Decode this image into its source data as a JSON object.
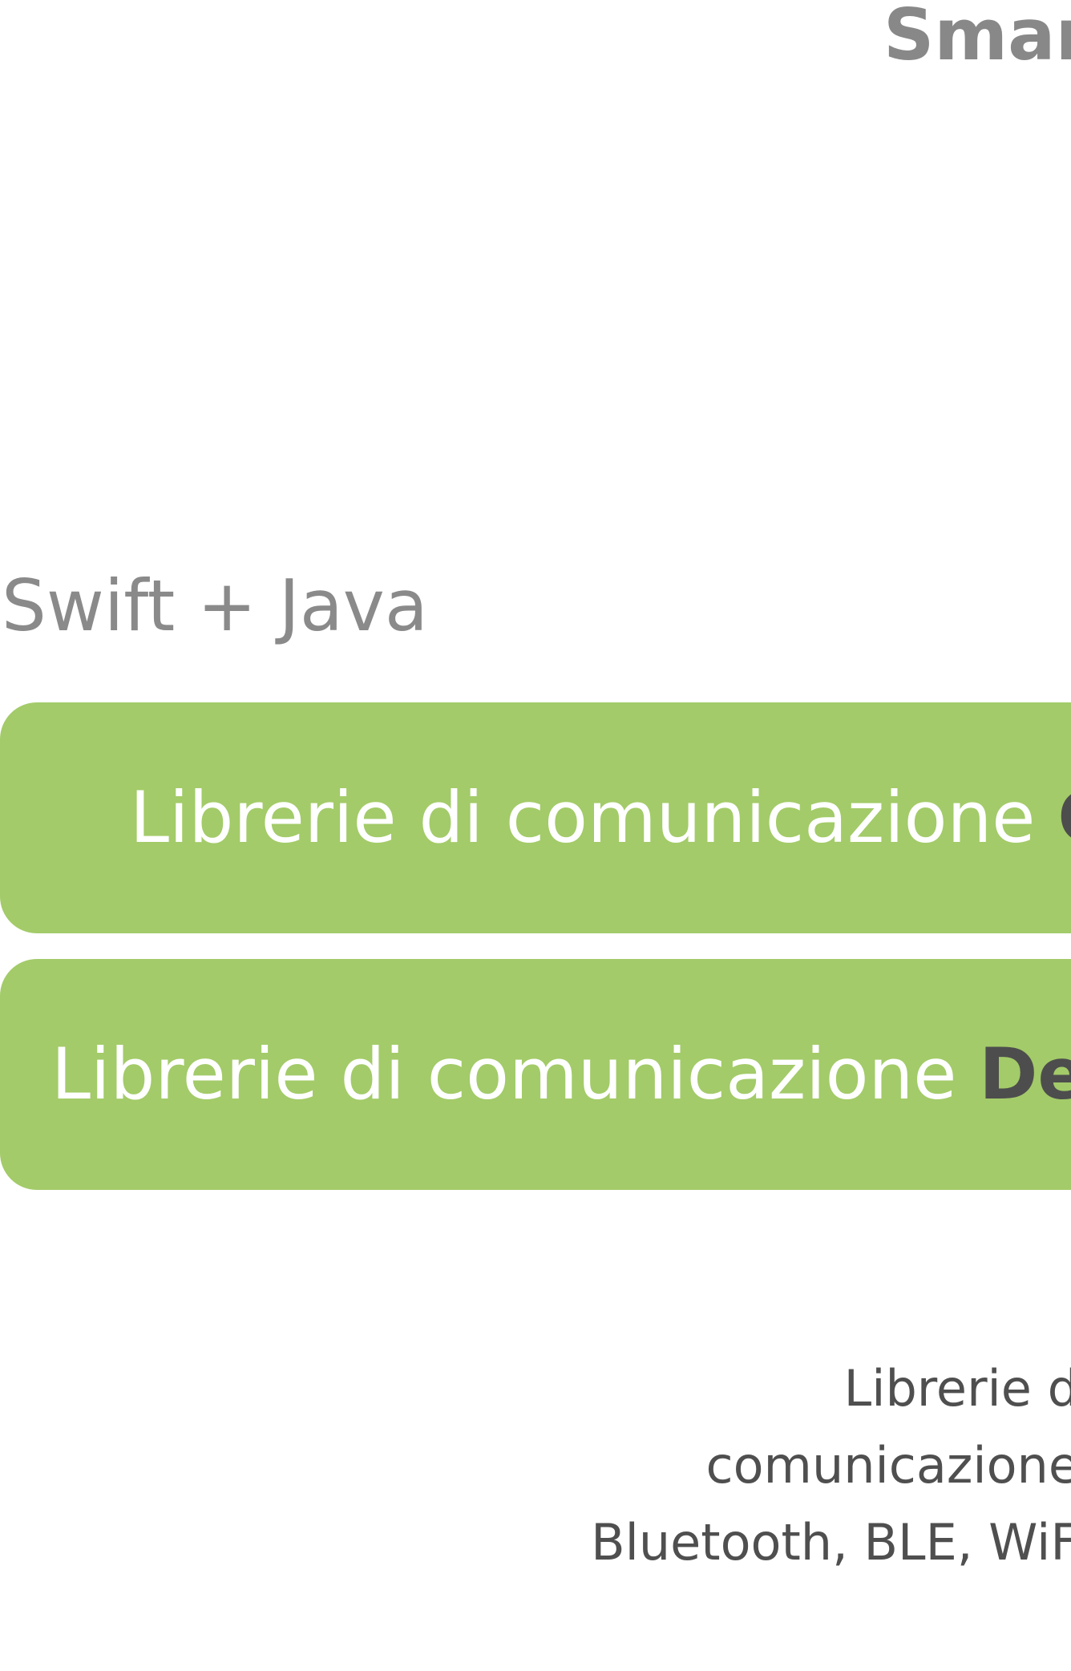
{
  "heading": "Smar",
  "language_label": "Swift + Java",
  "bars": [
    {
      "lead": "Librerie di comunicazione ",
      "strong": "Cl"
    },
    {
      "lead": "Librerie di comunicazione ",
      "strong": "Devi"
    }
  ],
  "note_lines": [
    "Librerie d",
    "comunicazione",
    "Bluetooth, BLE, WiF"
  ],
  "colors": {
    "bar_fill": "#a3cb69",
    "bar_text": "#ffffff",
    "bar_strong_text": "#4d4d4d",
    "muted_text": "#888888"
  }
}
